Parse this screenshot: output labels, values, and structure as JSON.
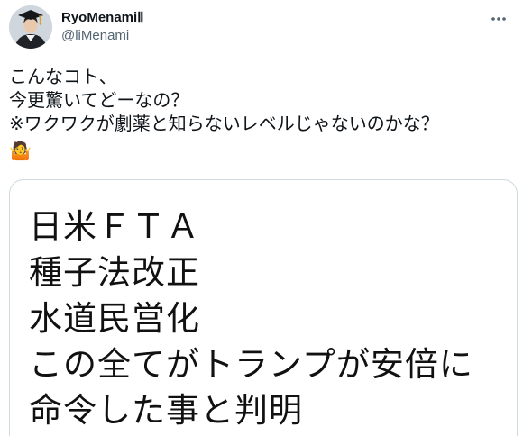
{
  "author": {
    "display_name": "RyoMenamiⅡ",
    "handle": "@liMenami",
    "avatar_icon": "graduate-avatar"
  },
  "menu_icon": "more-options-icon",
  "tweet": {
    "lines": [
      "こんなコト、",
      "今更驚いてどーなの？",
      "※ワクワクが劇薬と知らないレベルじゃないのかな？"
    ],
    "emoji": "🤷"
  },
  "media": {
    "lines": [
      "日米ＦＴＡ",
      "種子法改正",
      "水道民営化",
      "この全てがトランプが安倍に",
      "命令した事と判明"
    ]
  },
  "colors": {
    "text": "#0f1419",
    "secondary": "#536471",
    "border": "#cfd9de"
  }
}
